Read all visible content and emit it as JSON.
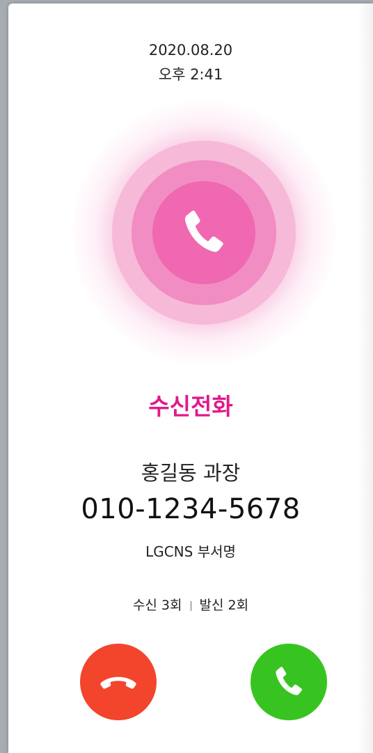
{
  "header": {
    "date": "2020.08.20",
    "time": "오후 2:41"
  },
  "call": {
    "status_title": "수신전화",
    "caller_name": "홍길동 과장",
    "phone_number": "010-1234-5678",
    "department": "LGCNS 부서명",
    "incoming_label": "수신 3회",
    "outgoing_label": "발신 2회"
  },
  "icons": {
    "center": "phone-icon",
    "decline": "hang-up-phone-icon",
    "accept": "phone-icon"
  },
  "colors": {
    "accent": "#e0198a",
    "ring_outer": "#f6b9d8",
    "ring_middle": "#f18dc2",
    "ring_inner": "#ef68b1",
    "decline": "#f2452c",
    "accept": "#38c420"
  }
}
